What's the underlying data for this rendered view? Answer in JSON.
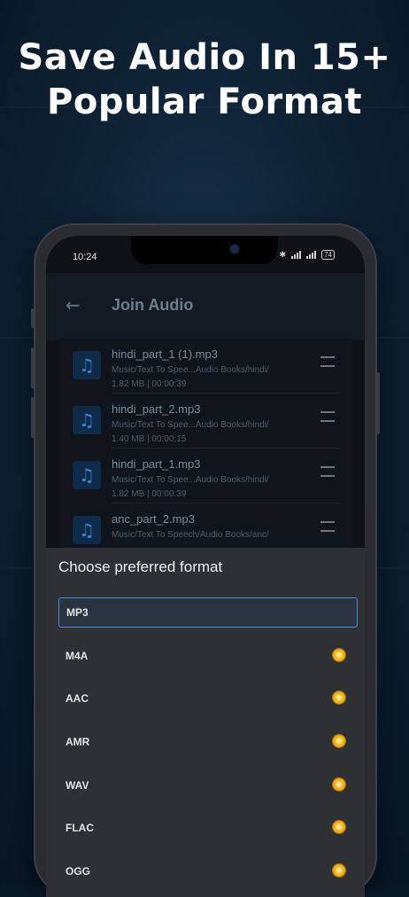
{
  "headline": [
    "Save Audio In 15+",
    "Popular Format"
  ],
  "status_bar": {
    "time": "10:24",
    "battery": "74"
  },
  "app_bar": {
    "title": "Join Audio",
    "back_icon": "arrow-left-icon"
  },
  "files": [
    {
      "name": "hindi_part_1 (1).mp3",
      "path": "Music/Text To Spee...Audio Books/hindi/",
      "meta": "1.82 MB | 00:00:39"
    },
    {
      "name": "hindi_part_2.mp3",
      "path": "Music/Text To Spee...Audio Books/hindi/",
      "meta": "1.40 MB | 00:00:15"
    },
    {
      "name": "hindi_part_1.mp3",
      "path": "Music/Text To Spee...Audio Books/hindi/",
      "meta": "1.82 MB | 00:00:39"
    },
    {
      "name": "anc_part_2.mp3",
      "path": "Music/Text To Speech/Audio Books/anc/",
      "meta": ""
    }
  ],
  "format_sheet": {
    "title": "Choose preferred format",
    "selected": "MP3",
    "options": [
      "MP3",
      "M4A",
      "AAC",
      "AMR",
      "WAV",
      "FLAC",
      "OGG"
    ],
    "premium_icon": "coin-icon"
  },
  "colors": {
    "accent": "#4a8fd6",
    "sheet_bg": "#2f3033",
    "coin": "#f2b21b"
  }
}
